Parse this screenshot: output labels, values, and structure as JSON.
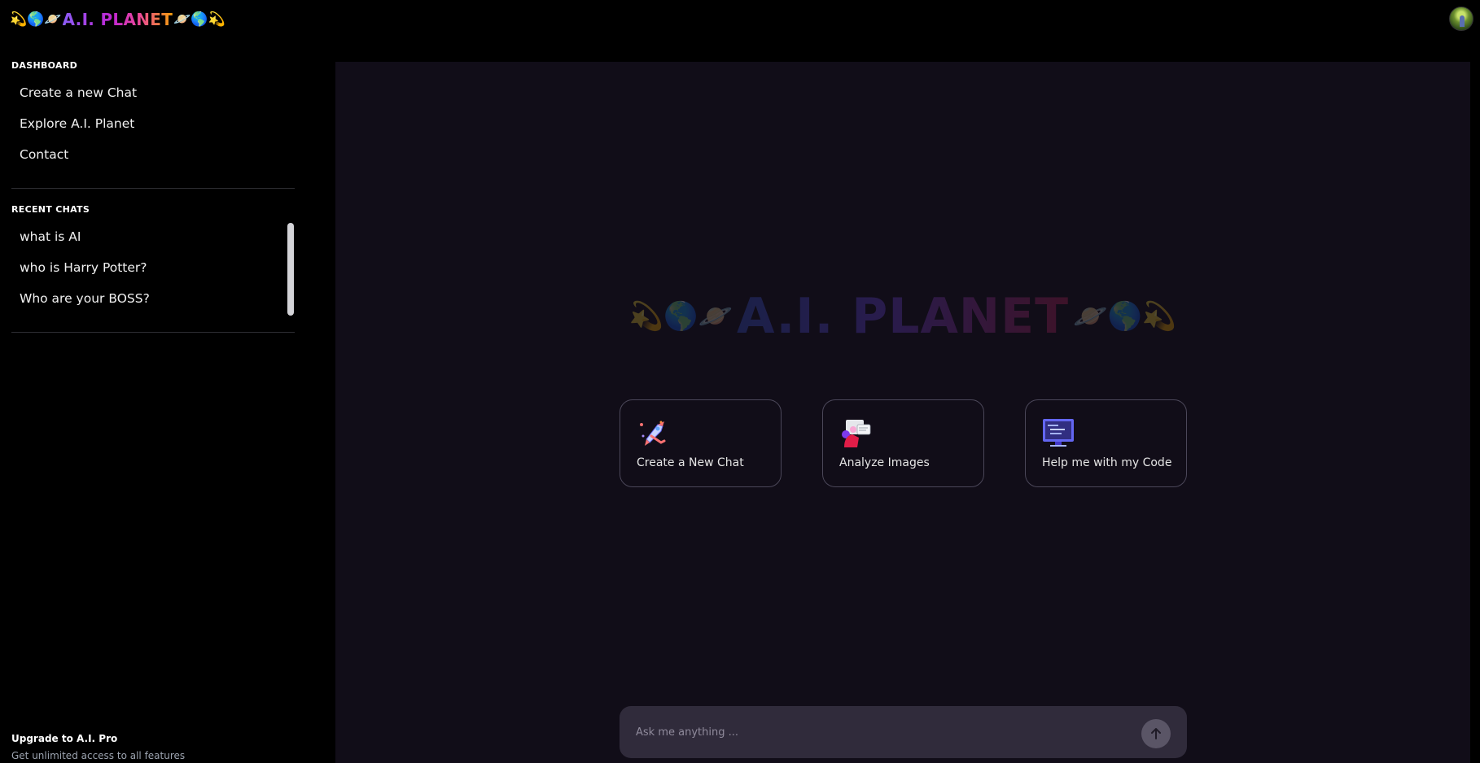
{
  "header": {
    "brand_prefix": "💫🌎🪐",
    "brand_title": "A.I. PLANET",
    "brand_suffix": "🪐🌎💫"
  },
  "sidebar": {
    "dashboard_label": "DASHBOARD",
    "nav_items": [
      {
        "label": "Create a new Chat"
      },
      {
        "label": "Explore A.I. Planet"
      },
      {
        "label": "Contact"
      }
    ],
    "recent_label": "RECENT CHATS",
    "recent_chats": [
      {
        "label": "what is AI"
      },
      {
        "label": "who is Harry Potter?"
      },
      {
        "label": "Who are your BOSS?"
      }
    ],
    "upgrade_title": "Upgrade to A.I. Pro",
    "upgrade_subtitle": "Get unlimited access to all features"
  },
  "main": {
    "hero_prefix": "💫🌎🪐",
    "hero_title": "A.I. PLANET",
    "hero_suffix": "🪐🌎💫",
    "cards": [
      {
        "label": "Create a New Chat",
        "icon": "rocket-icon"
      },
      {
        "label": "Analyze Images",
        "icon": "image-analysis-icon"
      },
      {
        "label": "Help me with my Code",
        "icon": "code-monitor-icon"
      }
    ],
    "chat_placeholder": "Ask me anything ..."
  },
  "colors": {
    "background": "#000000",
    "panel": "#110d18",
    "input_bg": "#302b3b",
    "card_border": "#4b4759"
  }
}
